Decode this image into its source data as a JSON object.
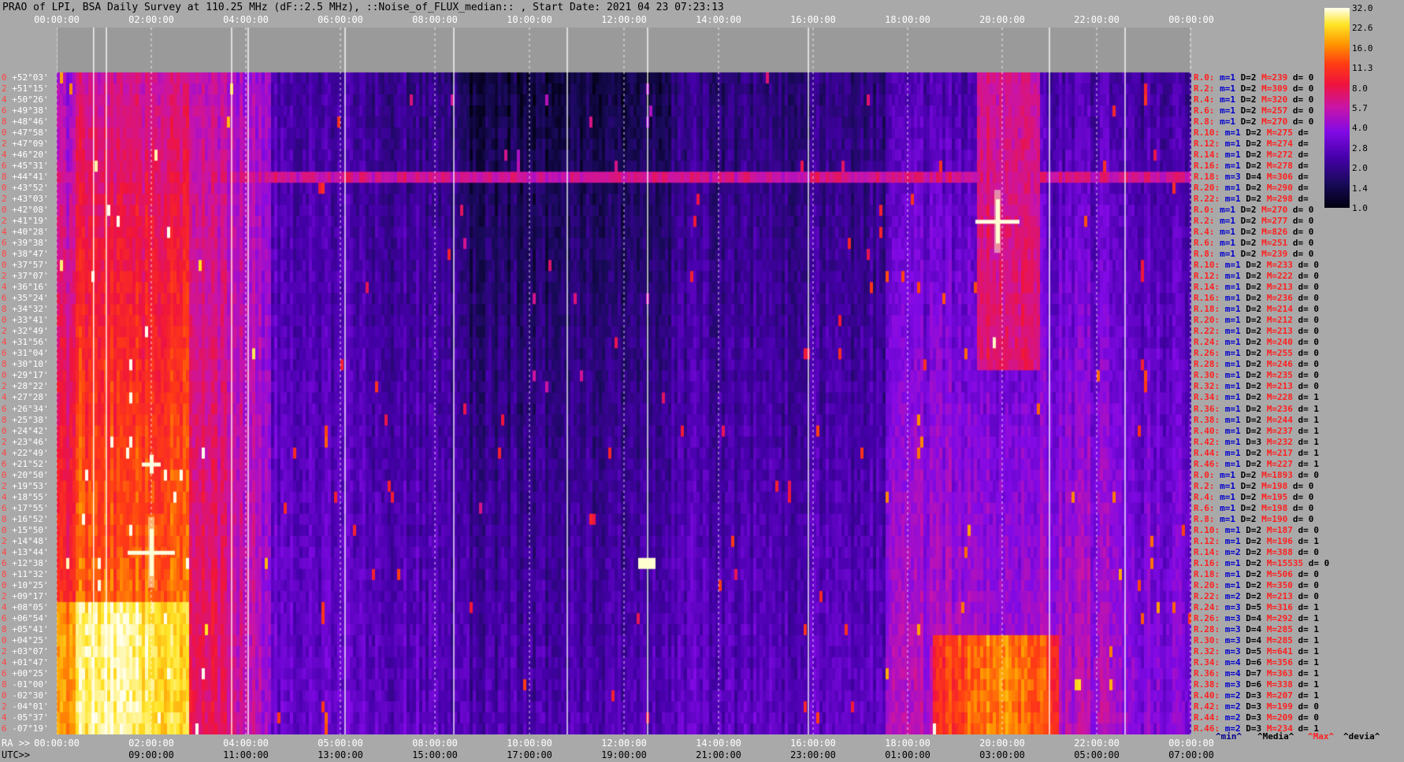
{
  "title": "PRAO of LPI, BSA Daily Survey at 110.25 MHz (dF::2.5 MHz), ::Noise_of_FLUX_median:: , Start Date: 2021 04 23 07:23:13",
  "top_ticks": [
    "00:00:00",
    "02:00:00",
    "04:00:00",
    "06:00:00",
    "08:00:00",
    "10:00:00",
    "12:00:00",
    "14:00:00",
    "16:00:00",
    "18:00:00",
    "20:00:00",
    "22:00:00",
    "00:00:00"
  ],
  "ra_label": "RA >>",
  "ra_ticks": [
    "00:00:00",
    "02:00:00",
    "04:00:00",
    "05:00:00",
    "08:00:00",
    "10:00:00",
    "12:00:00",
    "14:00:00",
    "16:00:00",
    "18:00:00",
    "20:00:00",
    "22:00:00",
    "00:00:00"
  ],
  "utc_label": "UTC>>",
  "utc_ticks": [
    "09:00:00",
    "11:00:00",
    "13:00:00",
    "15:00:00",
    "17:00:00",
    "19:00:00",
    "21:00:00",
    "23:00:00",
    "01:00:00",
    "03:00:00",
    "05:00:00",
    "07:00:00"
  ],
  "declinations": [
    "+52°03'",
    "+51°15'",
    "+50°26'",
    "+49°38'",
    "+48°46'",
    "+47°58'",
    "+47°09'",
    "+46°20'",
    "+45°31'",
    "+44°41'",
    "+43°52'",
    "+43°03'",
    "+42°08'",
    "+41°19'",
    "+40°28'",
    "+39°38'",
    "+38°47'",
    "+37°57'",
    "+37°07'",
    "+36°16'",
    "+35°24'",
    "+34°32'",
    "+33°41'",
    "+32°49'",
    "+31°56'",
    "+31°04'",
    "+30°10'",
    "+29°17'",
    "+28°22'",
    "+27°28'",
    "+26°34'",
    "+25°38'",
    "+24°42'",
    "+23°46'",
    "+22°49'",
    "+21°52'",
    "+20°50'",
    "+19°53'",
    "+18°55'",
    "+17°55'",
    "+16°52'",
    "+15°50'",
    "+14°48'",
    "+13°44'",
    "+12°38'",
    "+11°32'",
    "+10°25'",
    "+09°17'",
    "+08°05'",
    "+06°54'",
    "+05°41'",
    "+04°25'",
    "+03°07'",
    "+01°47'",
    "+00°25'",
    "-01°00'",
    "-02°30'",
    "-04°01'",
    "-05°37'",
    "-07°19'"
  ],
  "dec_index": [
    "0",
    "2",
    "4",
    "6",
    "8",
    "10",
    "12",
    "14",
    "16",
    "18",
    "20",
    "22",
    "0",
    "2",
    "4",
    "6",
    "8",
    "10",
    "12",
    "14",
    "16",
    "18",
    "20",
    "22",
    "24",
    "26",
    "28",
    "30",
    "32",
    "34",
    "36",
    "38",
    "40",
    "42",
    "44",
    "46",
    "0",
    "2",
    "4",
    "6",
    "8",
    "10",
    "12",
    "14",
    "16",
    "18",
    "20",
    "22",
    "24",
    "26",
    "28",
    "30",
    "32",
    "34",
    "36",
    "38",
    "40",
    "42",
    "44",
    "46"
  ],
  "receivers": [
    {
      "r": "R.0:",
      "m": "m=1",
      "d": "D=2",
      "M": "M=239",
      "dd": "d= 0"
    },
    {
      "r": "R.2:",
      "m": "m=1",
      "d": "D=2",
      "M": "M=309",
      "dd": "d= 0"
    },
    {
      "r": "R.4:",
      "m": "m=1",
      "d": "D=2",
      "M": "M=320",
      "dd": "d= 0"
    },
    {
      "r": "R.6:",
      "m": "m=1",
      "d": "D=2",
      "M": "M=257",
      "dd": "d= 0"
    },
    {
      "r": "R.8:",
      "m": "m=1",
      "d": "D=2",
      "M": "M=270",
      "dd": "d= 0"
    },
    {
      "r": "R.10:",
      "m": "m=1",
      "d": "D=2",
      "M": "M=275",
      "dd": "d="
    },
    {
      "r": "R.12:",
      "m": "m=1",
      "d": "D=2",
      "M": "M=274",
      "dd": "d="
    },
    {
      "r": "R.14:",
      "m": "m=1",
      "d": "D=2",
      "M": "M=272",
      "dd": "d="
    },
    {
      "r": "R.16:",
      "m": "m=1",
      "d": "D=2",
      "M": "M=278",
      "dd": "d="
    },
    {
      "r": "R.18:",
      "m": "m=3",
      "d": "D=4",
      "M": "M=306",
      "dd": "d="
    },
    {
      "r": "R.20:",
      "m": "m=1",
      "d": "D=2",
      "M": "M=290",
      "dd": "d="
    },
    {
      "r": "R.22:",
      "m": "m=1",
      "d": "D=2",
      "M": "M=298",
      "dd": "d="
    },
    {
      "r": "R.0:",
      "m": "m=1",
      "d": "D=2",
      "M": "M=270",
      "dd": "d= 0"
    },
    {
      "r": "R.2:",
      "m": "m=1",
      "d": "D=2",
      "M": "M=277",
      "dd": "d= 0"
    },
    {
      "r": "R.4:",
      "m": "m=1",
      "d": "D=2",
      "M": "M=826",
      "dd": "d= 0"
    },
    {
      "r": "R.6:",
      "m": "m=1",
      "d": "D=2",
      "M": "M=251",
      "dd": "d= 0"
    },
    {
      "r": "R.8:",
      "m": "m=1",
      "d": "D=2",
      "M": "M=239",
      "dd": "d= 0"
    },
    {
      "r": "R.10:",
      "m": "m=1",
      "d": "D=2",
      "M": "M=233",
      "dd": "d= 0"
    },
    {
      "r": "R.12:",
      "m": "m=1",
      "d": "D=2",
      "M": "M=222",
      "dd": "d= 0"
    },
    {
      "r": "R.14:",
      "m": "m=1",
      "d": "D=2",
      "M": "M=213",
      "dd": "d= 0"
    },
    {
      "r": "R.16:",
      "m": "m=1",
      "d": "D=2",
      "M": "M=236",
      "dd": "d= 0"
    },
    {
      "r": "R.18:",
      "m": "m=1",
      "d": "D=2",
      "M": "M=214",
      "dd": "d= 0"
    },
    {
      "r": "R.20:",
      "m": "m=1",
      "d": "D=2",
      "M": "M=212",
      "dd": "d= 0"
    },
    {
      "r": "R.22:",
      "m": "m=1",
      "d": "D=2",
      "M": "M=213",
      "dd": "d= 0"
    },
    {
      "r": "R.24:",
      "m": "m=1",
      "d": "D=2",
      "M": "M=240",
      "dd": "d= 0"
    },
    {
      "r": "R.26:",
      "m": "m=1",
      "d": "D=2",
      "M": "M=255",
      "dd": "d= 0"
    },
    {
      "r": "R.28:",
      "m": "m=1",
      "d": "D=2",
      "M": "M=246",
      "dd": "d= 0"
    },
    {
      "r": "R.30:",
      "m": "m=1",
      "d": "D=2",
      "M": "M=235",
      "dd": "d= 0"
    },
    {
      "r": "R.32:",
      "m": "m=1",
      "d": "D=2",
      "M": "M=213",
      "dd": "d= 0"
    },
    {
      "r": "R.34:",
      "m": "m=1",
      "d": "D=2",
      "M": "M=228",
      "dd": "d= 1"
    },
    {
      "r": "R.36:",
      "m": "m=1",
      "d": "D=2",
      "M": "M=236",
      "dd": "d= 1"
    },
    {
      "r": "R.38:",
      "m": "m=1",
      "d": "D=2",
      "M": "M=244",
      "dd": "d= 1"
    },
    {
      "r": "R.40:",
      "m": "m=1",
      "d": "D=2",
      "M": "M=237",
      "dd": "d= 1"
    },
    {
      "r": "R.42:",
      "m": "m=1",
      "d": "D=3",
      "M": "M=232",
      "dd": "d= 1"
    },
    {
      "r": "R.44:",
      "m": "m=1",
      "d": "D=2",
      "M": "M=217",
      "dd": "d= 1"
    },
    {
      "r": "R.46:",
      "m": "m=1",
      "d": "D=2",
      "M": "M=227",
      "dd": "d= 1"
    },
    {
      "r": "R.0:",
      "m": "m=1",
      "d": "D=2",
      "M": "M=1893",
      "dd": "d= 0"
    },
    {
      "r": "R.2:",
      "m": "m=1",
      "d": "D=2",
      "M": "M=198",
      "dd": "d= 0"
    },
    {
      "r": "R.4:",
      "m": "m=1",
      "d": "D=2",
      "M": "M=195",
      "dd": "d= 0"
    },
    {
      "r": "R.6:",
      "m": "m=1",
      "d": "D=2",
      "M": "M=198",
      "dd": "d= 0"
    },
    {
      "r": "R.8:",
      "m": "m=1",
      "d": "D=2",
      "M": "M=190",
      "dd": "d= 0"
    },
    {
      "r": "R.10:",
      "m": "m=1",
      "d": "D=2",
      "M": "M=187",
      "dd": "d= 0"
    },
    {
      "r": "R.12:",
      "m": "m=1",
      "d": "D=2",
      "M": "M=196",
      "dd": "d= 1"
    },
    {
      "r": "R.14:",
      "m": "m=2",
      "d": "D=2",
      "M": "M=388",
      "dd": "d= 0"
    },
    {
      "r": "R.16:",
      "m": "m=1",
      "d": "D=2",
      "M": "M=15535",
      "dd": "d= 0"
    },
    {
      "r": "R.18:",
      "m": "m=1",
      "d": "D=2",
      "M": "M=506",
      "dd": "d= 0"
    },
    {
      "r": "R.20:",
      "m": "m=1",
      "d": "D=2",
      "M": "M=350",
      "dd": "d= 0"
    },
    {
      "r": "R.22:",
      "m": "m=2",
      "d": "D=2",
      "M": "M=213",
      "dd": "d= 0"
    },
    {
      "r": "R.24:",
      "m": "m=3",
      "d": "D=5",
      "M": "M=316",
      "dd": "d= 1"
    },
    {
      "r": "R.26:",
      "m": "m=3",
      "d": "D=4",
      "M": "M=292",
      "dd": "d= 1"
    },
    {
      "r": "R.28:",
      "m": "m=3",
      "d": "D=4",
      "M": "M=285",
      "dd": "d= 1"
    },
    {
      "r": "R.30:",
      "m": "m=3",
      "d": "D=4",
      "M": "M=285",
      "dd": "d= 1"
    },
    {
      "r": "R.32:",
      "m": "m=3",
      "d": "D=5",
      "M": "M=641",
      "dd": "d= 1"
    },
    {
      "r": "R.34:",
      "m": "m=4",
      "d": "D=6",
      "M": "M=356",
      "dd": "d= 1"
    },
    {
      "r": "R.36:",
      "m": "m=4",
      "d": "D=7",
      "M": "M=363",
      "dd": "d= 1"
    },
    {
      "r": "R.38:",
      "m": "m=3",
      "d": "D=6",
      "M": "M=338",
      "dd": "d= 1"
    },
    {
      "r": "R.40:",
      "m": "m=2",
      "d": "D=3",
      "M": "M=207",
      "dd": "d= 1"
    },
    {
      "r": "R.42:",
      "m": "m=2",
      "d": "D=3",
      "M": "M=199",
      "dd": "d= 0"
    },
    {
      "r": "R.44:",
      "m": "m=2",
      "d": "D=3",
      "M": "M=209",
      "dd": "d= 0"
    },
    {
      "r": "R.46:",
      "m": "m=2",
      "d": "D=3",
      "M": "M=234",
      "dd": "d= 1"
    }
  ],
  "legend": {
    "min": "^min^",
    "median": "^Media^",
    "max": "^Max^",
    "devia": "^devia^"
  },
  "colors": {
    "receiver_label": "#ff2020",
    "receiver_m": "#0000cc",
    "receiver_D": "#000000",
    "receiver_M": "#ff2020",
    "receiver_d": "#000000",
    "max_legend": "#ff2020",
    "bg": "#a9a9a9"
  },
  "chart_data": {
    "type": "heatmap",
    "title": "PRAO of LPI, BSA Daily Survey at 110.25 MHz (dF::2.5 MHz), ::Noise_of_FLUX_median:: , Start Date: 2021 04 23 07:23:13",
    "x_axis": "RA (sidereal time) 00:00:00 to 24:00:00, with UTC secondary axis",
    "y_axis": "Declination +52°03' to -07°19' (60 beams)",
    "colorbar": {
      "ticks": [
        "32.0",
        "22.6",
        "16.0",
        "11.3",
        "8.0",
        "5.7",
        "4.0",
        "2.8",
        "2.0",
        "1.4",
        "1.0"
      ],
      "scale": "log",
      "min": 1.0,
      "max": 32.0,
      "colormap": "gnuplot (black-blue-purple-red-yellow-white)"
    },
    "bright_regions": [
      {
        "ra_hours": [
          0.5,
          2.8
        ],
        "dec_range": [
          "+09°17'",
          "-07°19'"
        ],
        "level": "high (~20-32)"
      },
      {
        "ra_hours": [
          0.0,
          2.8
        ],
        "dec_range": [
          "+52°03'",
          "+09°17'"
        ],
        "level": "elevated (~6-16)"
      },
      {
        "ra_hours": [
          18.0,
          22.0
        ],
        "dec_range": [
          "+08°05'",
          "-02°30'"
        ],
        "level": "high (~8-20)"
      },
      {
        "ra_hours": [
          9.0,
          13.0
        ],
        "dec_range": [
          "+45°31'",
          "+20°50'"
        ],
        "level": "low (~1-2)"
      }
    ],
    "point_sources": [
      {
        "ra": "02:00:00",
        "dec": "+13°44'",
        "label": "bright cross"
      },
      {
        "ra": "02:00:00",
        "dec": "+21°52'",
        "label": "cross"
      },
      {
        "ra": "19:50:00",
        "dec": "+41°19'",
        "label": "bright cross"
      },
      {
        "ra": "12:30:00",
        "dec": "+12°38'",
        "label": "spot"
      }
    ],
    "horizontal_band": {
      "dec": "+44°41'",
      "level": "elevated"
    }
  }
}
